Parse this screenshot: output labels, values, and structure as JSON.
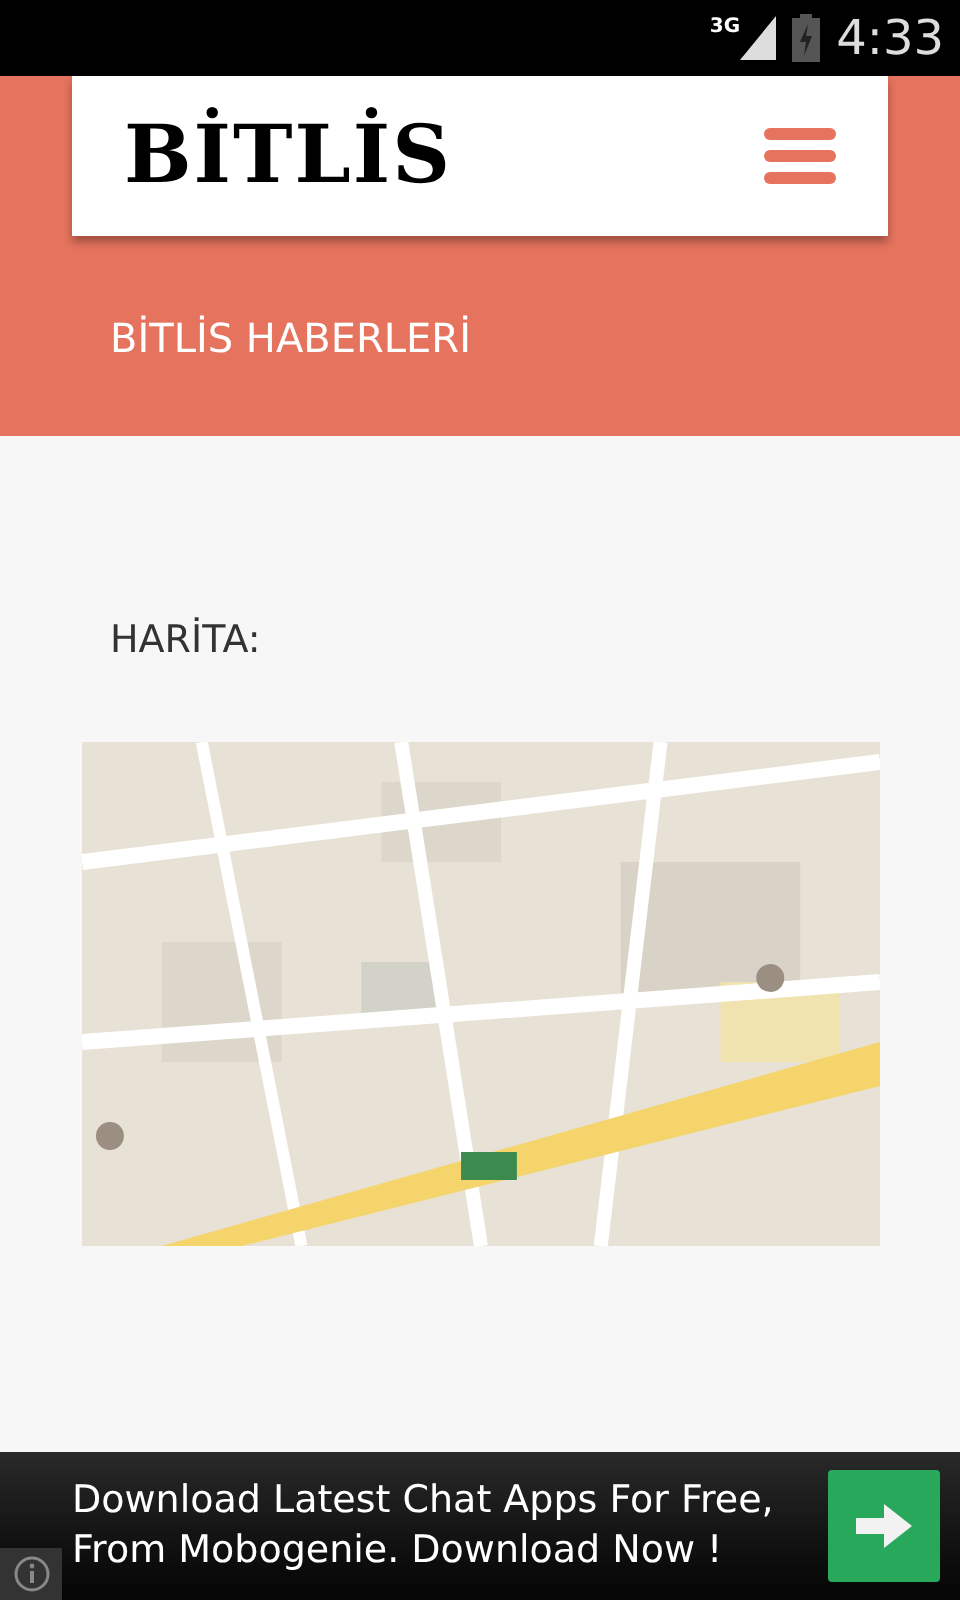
{
  "status_bar": {
    "network": "3G",
    "time": "4:33"
  },
  "header": {
    "logo": "BİTLİS",
    "subtitle": "BİTLİS HABERLERİ"
  },
  "content": {
    "heading": "HARİTA:"
  },
  "ad": {
    "text": "Download Latest Chat Apps For Free, From Mobogenie. Download Now !"
  }
}
